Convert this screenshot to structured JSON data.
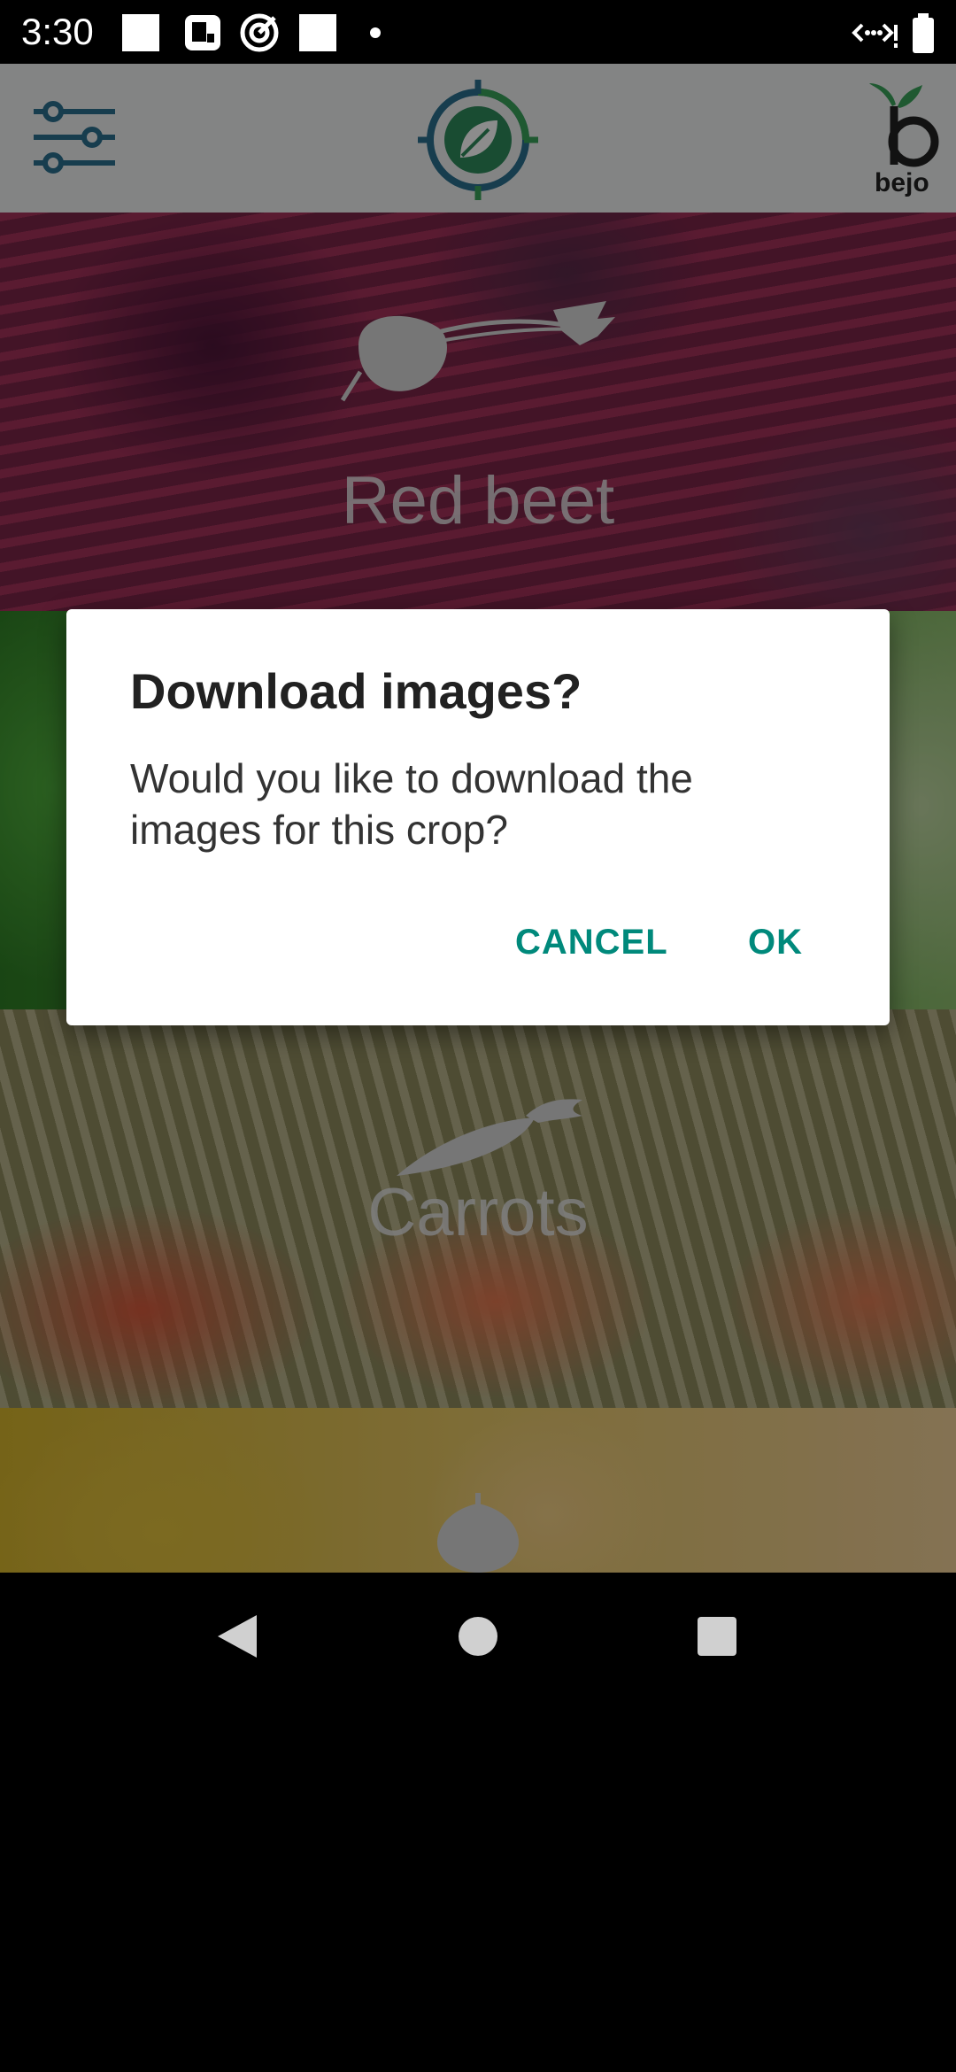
{
  "status_bar": {
    "time": "3:30"
  },
  "app_bar": {
    "left_icon": "filter-sliders-icon",
    "center_logo": "leaf-target-logo",
    "right_logo_text": "bejo"
  },
  "crops": [
    {
      "label": "Red beet",
      "icon": "beet-icon"
    },
    {
      "label": "",
      "icon": ""
    },
    {
      "label": "Carrots",
      "icon": "carrot-icon"
    },
    {
      "label": "",
      "icon": "onion-icon"
    }
  ],
  "dialog": {
    "title": "Download images?",
    "message": "Would you like to download the images for this crop?",
    "cancel_label": "CANCEL",
    "ok_label": "OK"
  },
  "colors": {
    "accent": "#00897b",
    "app_bar_bg": "#eef0f0",
    "logo_blue": "#2a6f8f",
    "logo_green": "#3aa35a"
  }
}
